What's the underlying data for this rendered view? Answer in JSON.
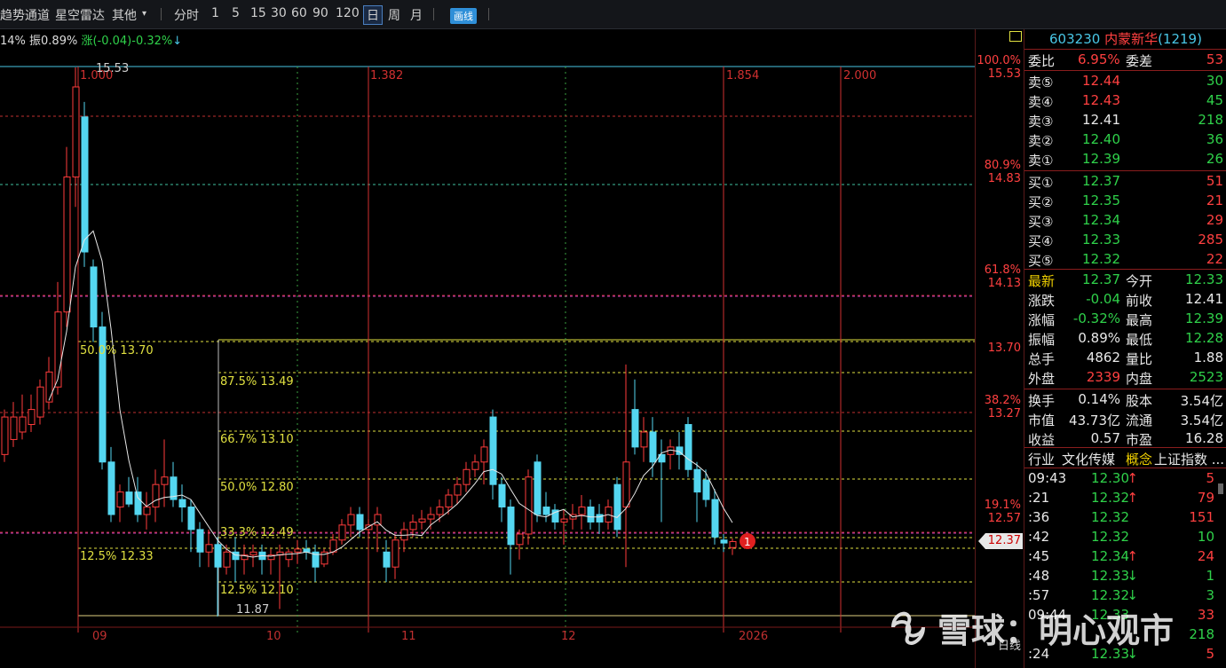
{
  "toolbar": {
    "items": [
      "趋势通道",
      "星空雷达",
      "其他"
    ],
    "periods": [
      "分时",
      "1",
      "5",
      "15",
      "30",
      "60",
      "90",
      "120"
    ],
    "active_period": "日",
    "week": "周",
    "month": "月",
    "draw_button": "画线"
  },
  "info_line": {
    "part1": "14% 振0.89% ",
    "part2": "涨(-0.04)-0.32%",
    "part3": "↓"
  },
  "chart": {
    "fib_time_labels": [
      "1.000",
      "1.382",
      "1.854",
      "2.000"
    ],
    "retracement_labels": [
      "50.0% 13.70",
      "87.5% 13.49",
      "66.7% 13.10",
      "50.0% 12.80",
      "33.3% 12.49",
      "12.5% 12.33",
      "12.5% 12.10"
    ],
    "high_label": "15.53",
    "low_label": "11.87",
    "x_labels": [
      "09",
      "10",
      "11",
      "12",
      "2026"
    ],
    "marker": "1",
    "colors": {
      "up": "#ff3b3b",
      "down": "#54d6f0",
      "ma": "#e8e8e8",
      "fib": "#e0e040",
      "vline": "#d03030"
    }
  },
  "scale": {
    "labels": [
      {
        "pct": "100.0%",
        "price": "15.53"
      },
      {
        "pct": "80.9%",
        "price": "14.83"
      },
      {
        "pct": "61.8%",
        "price": "14.13"
      },
      {
        "pct": "",
        "price": "13.70"
      },
      {
        "pct": "38.2%",
        "price": "13.27"
      },
      {
        "pct": "19.1%",
        "price": "12.57"
      }
    ],
    "current_price": "12.37",
    "bottom_label": "日线"
  },
  "panel": {
    "code": "603230",
    "name": "内蒙新华",
    "num": "(1219)",
    "weibi_label": "委比",
    "weibi": "6.95%",
    "weicha_label": "委差",
    "weicha": "53",
    "asks": [
      {
        "label": "卖⑤",
        "price": "12.44",
        "vol": "30"
      },
      {
        "label": "卖④",
        "price": "12.43",
        "vol": "45"
      },
      {
        "label": "卖③",
        "price": "12.41",
        "vol": "218"
      },
      {
        "label": "卖②",
        "price": "12.40",
        "vol": "36"
      },
      {
        "label": "卖①",
        "price": "12.39",
        "vol": "26"
      }
    ],
    "bids": [
      {
        "label": "买①",
        "price": "12.37",
        "vol": "51"
      },
      {
        "label": "买②",
        "price": "12.35",
        "vol": "21"
      },
      {
        "label": "买③",
        "price": "12.34",
        "vol": "29"
      },
      {
        "label": "买④",
        "price": "12.33",
        "vol": "285"
      },
      {
        "label": "买⑤",
        "price": "12.32",
        "vol": "22"
      }
    ],
    "stats": [
      {
        "l1": "最新",
        "v1": "12.37",
        "c1": "grn",
        "l2": "今开",
        "v2": "12.33",
        "c2": "grn"
      },
      {
        "l1": "涨跌",
        "v1": "-0.04",
        "c1": "grn",
        "l2": "前收",
        "v2": "12.41",
        "c2": "wht"
      },
      {
        "l1": "涨幅",
        "v1": "-0.32%",
        "c1": "grn",
        "l2": "最高",
        "v2": "12.39",
        "c2": "grn"
      },
      {
        "l1": "振幅",
        "v1": "0.89%",
        "c1": "wht",
        "l2": "最低",
        "v2": "12.28",
        "c2": "grn"
      },
      {
        "l1": "总手",
        "v1": "4862",
        "c1": "wht",
        "l2": "量比",
        "v2": "1.88",
        "c2": "wht"
      },
      {
        "l1": "外盘",
        "v1": "2339",
        "c1": "red",
        "l2": "内盘",
        "v2": "2523",
        "c2": "grn"
      }
    ],
    "stats2": [
      {
        "l1": "换手",
        "v1": "0.14%",
        "l2": "股本",
        "v2": "3.54亿"
      },
      {
        "l1": "市值",
        "v1": "43.73亿",
        "l2": "流通",
        "v2": "3.54亿"
      },
      {
        "l1": "收益",
        "v1": "0.57",
        "l2": "市盈",
        "v2": "16.28"
      }
    ],
    "industry_label": "行业",
    "industry": "文化传媒",
    "concept_label": "概念",
    "concept": "上证指数 ...",
    "ticks": [
      {
        "t": "09:43",
        "p": "12.30",
        "a": "↑",
        "ac": "red",
        "v": "5",
        "vc": "red"
      },
      {
        "t": ":21",
        "p": "12.32",
        "a": "↑",
        "ac": "red",
        "v": "79",
        "vc": "red"
      },
      {
        "t": ":36",
        "p": "12.32",
        "a": "",
        "ac": "red",
        "v": "151",
        "vc": "red"
      },
      {
        "t": ":42",
        "p": "12.32",
        "a": "",
        "ac": "red",
        "v": "10",
        "vc": "grn"
      },
      {
        "t": ":45",
        "p": "12.34",
        "a": "↑",
        "ac": "red",
        "v": "24",
        "vc": "red"
      },
      {
        "t": ":48",
        "p": "12.33",
        "a": "↓",
        "ac": "grn",
        "v": "1",
        "vc": "grn"
      },
      {
        "t": ":57",
        "p": "12.32",
        "a": "↓",
        "ac": "grn",
        "v": "3",
        "vc": "grn"
      },
      {
        "t": "09:44",
        "p": "12.33",
        "a": "",
        "ac": "red",
        "v": "33",
        "vc": "red"
      },
      {
        "t": "",
        "p": "",
        "a": "",
        "ac": "red",
        "v": "218",
        "vc": "grn"
      },
      {
        "t": ":24",
        "p": "12.33",
        "a": "↓",
        "ac": "grn",
        "v": "5",
        "vc": "red"
      }
    ]
  },
  "watermark": "雪球：明心观市"
}
